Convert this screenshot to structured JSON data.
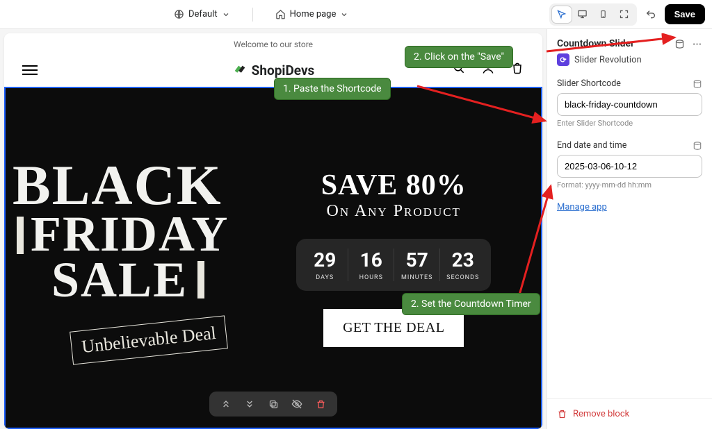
{
  "top": {
    "templateLabel": "Default",
    "pageLabel": "Home page",
    "save": "Save"
  },
  "store": {
    "announce": "Welcome to our store",
    "brand": "ShopiDevs"
  },
  "hero": {
    "line1": "BLACK",
    "line2": "FRIDAY",
    "line3": "SALE",
    "badge": "Unbelievable Deal",
    "saveLine1": "SAVE 80%",
    "saveLine2": "On Any Product",
    "cta": "GET THE DEAL",
    "countdown": [
      {
        "num": "29",
        "lab": "DAYS"
      },
      {
        "num": "16",
        "lab": "HOURS"
      },
      {
        "num": "57",
        "lab": "MINUTES"
      },
      {
        "num": "23",
        "lab": "SECONDS"
      }
    ]
  },
  "sidebar": {
    "blockTitle": "Countdown Slider",
    "sourceName": "Slider Revolution",
    "shortcodeLabel": "Slider Shortcode",
    "shortcodeValue": "black-friday-countdown",
    "shortcodeHelper": "Enter Slider Shortcode",
    "endLabel": "End date and time",
    "endValue": "2025-03-06-10-12",
    "endHelper": "Format: yyyy-mm-dd hh:mm",
    "manage": "Manage app",
    "remove": "Remove block"
  },
  "annot": {
    "a1": "1. Paste the Shortcode",
    "a2": "2. Click on the \"Save\"",
    "a3": "2. Set the Countdown Timer"
  }
}
